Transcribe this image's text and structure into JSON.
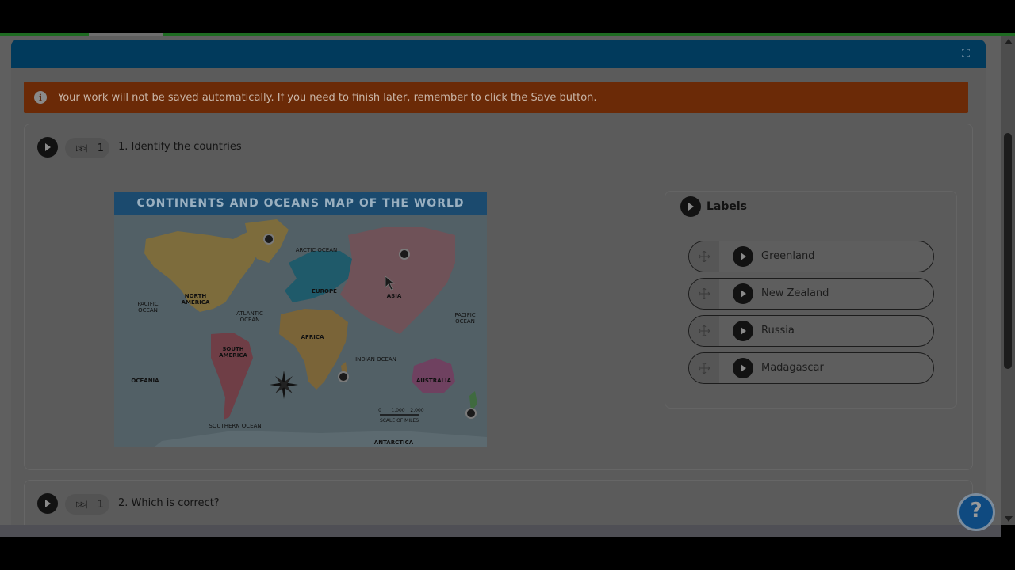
{
  "banner": {
    "text": "Your work will not be saved automatically. If you need to finish later, remember to click the Save button.",
    "icon": "info-icon"
  },
  "questions": [
    {
      "number": "1",
      "count": "1",
      "title": "1. Identify the countries"
    },
    {
      "number": "2",
      "count": "1",
      "title": "2. Which is correct?"
    }
  ],
  "map": {
    "title": "CONTINENTS AND OCEANS MAP OF THE WORLD",
    "labels": {
      "north_america": "NORTH AMERICA",
      "south_america": "SOUTH AMERICA",
      "europe": "EUROPE",
      "asia": "ASIA",
      "africa": "AFRICA",
      "australia": "AUSTRALIA",
      "oceania": "OCEANIA",
      "antarctica": "ANTARCTICA",
      "arctic_ocean": "ARCTIC OCEAN",
      "pacific_ocean_left": "PACIFIC OCEAN",
      "pacific_ocean_right": "PACIFIC OCEAN",
      "atlantic_ocean": "ATLANTIC OCEAN",
      "indian_ocean": "INDIAN OCEAN",
      "southern_ocean": "SOUTHERN OCEAN",
      "scale": "SCALE OF MILES",
      "scale_ticks": [
        "0",
        "1,000",
        "2,000"
      ]
    }
  },
  "labels_panel": {
    "title": "Labels",
    "items": [
      "Greenland",
      "New Zealand",
      "Russia",
      "Madagascar"
    ]
  },
  "help_button": {
    "label": "?"
  },
  "colors": {
    "header": "#013a5c",
    "banner": "#6b2a07",
    "progress": "#1e6b22"
  }
}
